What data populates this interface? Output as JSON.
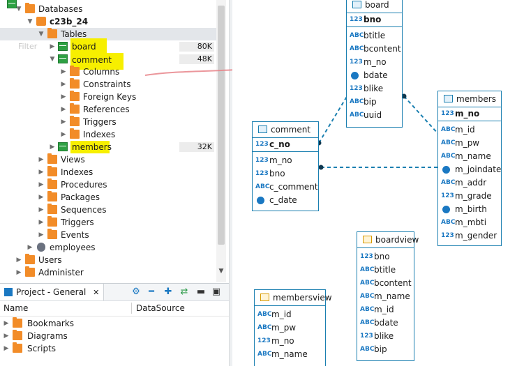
{
  "tree": {
    "databases": "Databases",
    "schema": "c23b_24",
    "tables": "Tables",
    "table_items": [
      {
        "name": "board",
        "size": "80K"
      },
      {
        "name": "comment",
        "size": "48K"
      },
      {
        "name": "members",
        "size": "32K"
      }
    ],
    "comment_children": [
      "Columns",
      "Constraints",
      "Foreign Keys",
      "References",
      "Triggers",
      "Indexes"
    ],
    "schema_children": [
      "Views",
      "Indexes",
      "Procedures",
      "Packages",
      "Sequences",
      "Triggers",
      "Events"
    ],
    "other_db": "employees",
    "users": "Users",
    "administer": "Administer",
    "ghost_label": "Filter"
  },
  "project": {
    "tab_title": "Project - General",
    "close": "✕",
    "col_name": "Name",
    "col_datasource": "DataSource",
    "items": [
      "Bookmarks",
      "Diagrams",
      "Scripts"
    ]
  },
  "diagram": {
    "entities": {
      "board": {
        "title": "board",
        "pk": {
          "type": "123",
          "name": "bno"
        },
        "cols": [
          {
            "type": "ABC",
            "name": "btitle"
          },
          {
            "type": "ABC",
            "name": "bcontent"
          },
          {
            "type": "123",
            "name": "m_no"
          },
          {
            "type": "clock",
            "name": "bdate"
          },
          {
            "type": "123",
            "name": "blike"
          },
          {
            "type": "ABC",
            "name": "bip"
          },
          {
            "type": "ABC",
            "name": "uuid"
          }
        ]
      },
      "comment": {
        "title": "comment",
        "pk": {
          "type": "123",
          "name": "c_no"
        },
        "cols": [
          {
            "type": "123",
            "name": "m_no"
          },
          {
            "type": "123",
            "name": "bno"
          },
          {
            "type": "ABC",
            "name": "c_comment"
          },
          {
            "type": "clock",
            "name": "c_date"
          }
        ]
      },
      "members": {
        "title": "members",
        "pk": {
          "type": "123",
          "name": "m_no"
        },
        "cols": [
          {
            "type": "ABC",
            "name": "m_id"
          },
          {
            "type": "ABC",
            "name": "m_pw"
          },
          {
            "type": "ABC",
            "name": "m_name"
          },
          {
            "type": "clock",
            "name": "m_joindate"
          },
          {
            "type": "ABC",
            "name": "m_addr"
          },
          {
            "type": "123",
            "name": "m_grade"
          },
          {
            "type": "clock",
            "name": "m_birth"
          },
          {
            "type": "ABC",
            "name": "m_mbti"
          },
          {
            "type": "123",
            "name": "m_gender"
          }
        ]
      },
      "boardview": {
        "title": "boardview",
        "cols": [
          {
            "type": "123",
            "name": "bno"
          },
          {
            "type": "ABC",
            "name": "btitle"
          },
          {
            "type": "ABC",
            "name": "bcontent"
          },
          {
            "type": "ABC",
            "name": "m_name"
          },
          {
            "type": "ABC",
            "name": "m_id"
          },
          {
            "type": "ABC",
            "name": "bdate"
          },
          {
            "type": "123",
            "name": "blike"
          },
          {
            "type": "ABC",
            "name": "bip"
          }
        ]
      },
      "membersview": {
        "title": "membersview",
        "cols": [
          {
            "type": "ABC",
            "name": "m_id"
          },
          {
            "type": "ABC",
            "name": "m_pw"
          },
          {
            "type": "123",
            "name": "m_no"
          },
          {
            "type": "ABC",
            "name": "m_name"
          }
        ]
      }
    }
  },
  "colors": {
    "accent": "#1a7fb0",
    "highlight": "#f7ef00",
    "folder": "#f28c28",
    "table_icon": "#2ea043",
    "annotation_arrow": "#e8848a"
  }
}
